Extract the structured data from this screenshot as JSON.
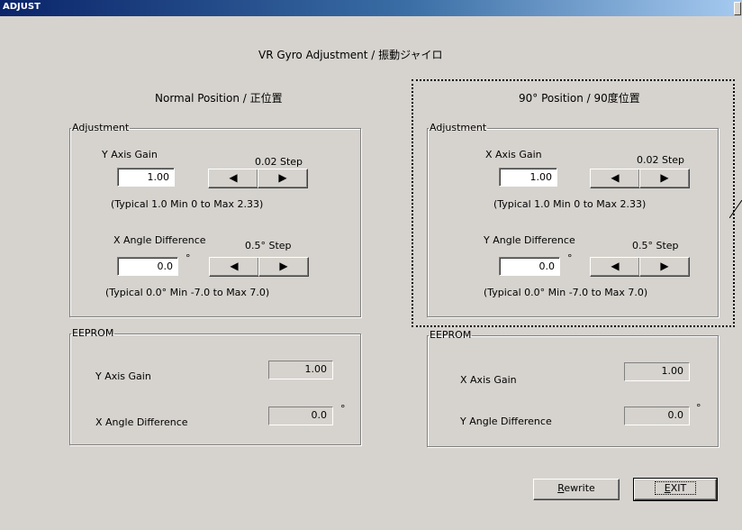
{
  "window": {
    "title": "ADJUST"
  },
  "header": {
    "title": "VR Gyro Adjustment / 振動ジャイロ"
  },
  "normal": {
    "title": "Normal Position / 正位置",
    "adjustment": {
      "legend": "Adjustment",
      "gain_label": "Y Axis Gain",
      "gain_step": "0.02 Step",
      "gain_value": "1.00",
      "gain_hint": "(Typical 1.0 Min 0 to Max 2.33)",
      "angle_label": "X Angle Difference",
      "angle_step": "0.5° Step",
      "angle_value": "0.0",
      "angle_unit": "°",
      "angle_hint": "(Typical 0.0° Min -7.0 to Max 7.0)"
    },
    "eeprom": {
      "legend": "EEPROM",
      "gain_label": "Y Axis Gain",
      "gain_value": "1.00",
      "angle_label": "X Angle Difference",
      "angle_value": "0.0",
      "angle_unit": "°"
    }
  },
  "rotated": {
    "title": "90° Position / 90度位置",
    "adjustment": {
      "legend": "Adjustment",
      "gain_label": "X Axis Gain",
      "gain_step": "0.02 Step",
      "gain_value": "1.00",
      "gain_hint": "(Typical 1.0 Min 0 to Max 2.33)",
      "angle_label": "Y Angle Difference",
      "angle_step": "0.5° Step",
      "angle_value": "0.0",
      "angle_unit": "°",
      "angle_hint": "(Typical 0.0° Min -7.0 to Max 7.0)"
    },
    "eeprom": {
      "legend": "EEPROM",
      "gain_label": "X Axis Gain",
      "gain_value": "1.00",
      "angle_label": "Y Angle Difference",
      "angle_value": "0.0",
      "angle_unit": "°"
    }
  },
  "buttons": {
    "decrement": "◀",
    "increment": "▶",
    "rewrite_mnemonic": "R",
    "rewrite_rest": "ewrite",
    "exit_mnemonic": "E",
    "exit_rest": "XIT"
  }
}
